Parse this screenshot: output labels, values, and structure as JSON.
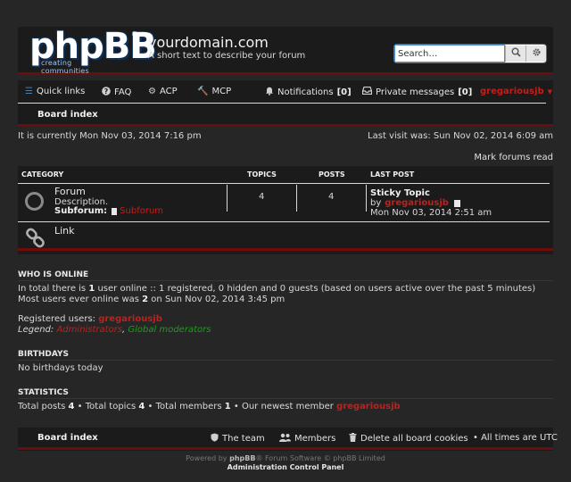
{
  "header": {
    "logo_text": "phpBB",
    "logo_sub": "creating communities",
    "logo_reg": "®",
    "site_title": "yourdomain.com",
    "site_desc": "A short text to describe your forum",
    "search_placeholder": "Search…"
  },
  "nav": {
    "quick_links": "Quick links",
    "faq": "FAQ",
    "acp": "ACP",
    "mcp": "MCP",
    "notifications": "Notifications",
    "notifications_count": "[0]",
    "private_messages": "Private messages",
    "pm_count": "[0]",
    "user": "gregariousjb",
    "board_index": "Board index"
  },
  "info": {
    "current_time": "It is currently Mon Nov 03, 2014 7:16 pm",
    "last_visit": "Last visit was: Sun Nov 02, 2014 6:09 am",
    "mark_read": "Mark forums read"
  },
  "forum_table": {
    "headers": {
      "category": "CATEGORY",
      "topics": "TOPICS",
      "posts": "POSTS",
      "last_post": "LAST POST"
    },
    "forum": {
      "name": "Forum",
      "description": "Description.",
      "subforum_label": "Subforum:",
      "subforum": "Subforum",
      "topics": "4",
      "posts": "4",
      "last_post_title": "Sticky Topic",
      "last_post_by": "by",
      "last_post_user": "gregariousjb",
      "last_post_time": "Mon Nov 03, 2014 2:51 am"
    },
    "link": {
      "name": "Link"
    }
  },
  "who_is_online": {
    "title": "WHO IS ONLINE",
    "line1_pre": "In total there is ",
    "line1_num": "1",
    "line1_post": " user online :: 1 registered, 0 hidden and 0 guests (based on users active over the past 5 minutes)",
    "line2_pre": "Most users ever online was ",
    "line2_num": "2",
    "line2_post": " on Sun Nov 02, 2014 3:45 pm",
    "registered_label": "Registered users: ",
    "registered_user": "gregariousjb",
    "legend_label": "Legend: ",
    "legend_admins": "Administrators",
    "legend_sep": ", ",
    "legend_mods": "Global moderators"
  },
  "birthdays": {
    "title": "BIRTHDAYS",
    "text": "No birthdays today"
  },
  "statistics": {
    "title": "STATISTICS",
    "posts_label": "Total posts ",
    "posts": "4",
    "topics_label": " • Total topics ",
    "topics": "4",
    "members_label": " • Total members ",
    "members": "1",
    "newest_label": " • Our newest member ",
    "newest": "gregariousjb"
  },
  "footer": {
    "board_index": "Board index",
    "team": "The team",
    "members": "Members",
    "delete_cookies": "Delete all board cookies",
    "timezone": "• All times are UTC",
    "powered_pre": "Powered by ",
    "powered_brand": "phpBB",
    "powered_post": "® Forum Software © phpBB Limited",
    "acp_link": "Administration Control Panel"
  },
  "colors": {
    "accent_red": "#c0201c",
    "panel": "#1b1b1b",
    "border_red": "#6e0c0c",
    "green": "#17a017"
  }
}
